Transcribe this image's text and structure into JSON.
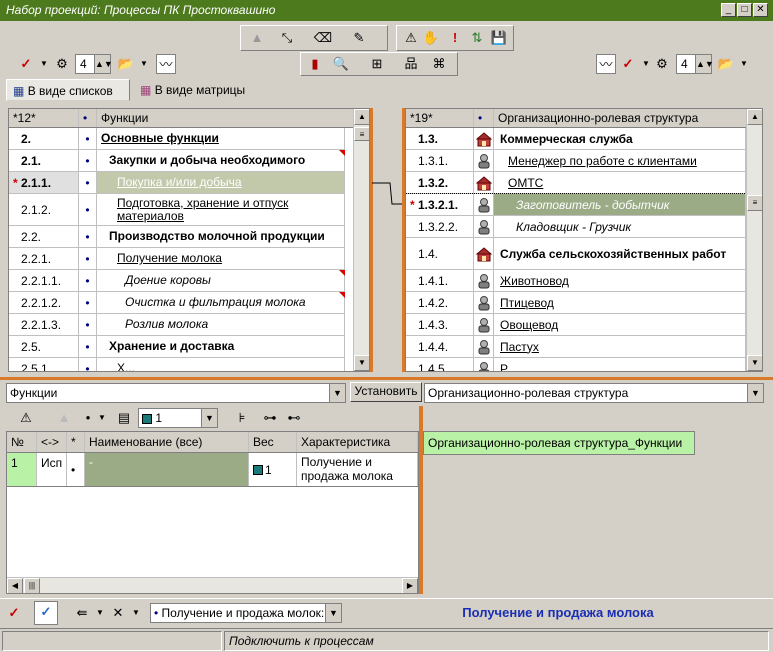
{
  "window": {
    "title": "Набор проекций: Процессы ПК Простоквашино"
  },
  "view_tabs": {
    "list_view": "В виде списков",
    "matrix_view": "В виде матрицы"
  },
  "left_spin": "4",
  "right_spin": "4",
  "left_grid": {
    "header_num": "*12*",
    "header_dot": "•",
    "header_name": "Функции",
    "rows": [
      {
        "mark": "",
        "num": "2.",
        "dot": "•",
        "name": "Основные функции"
      },
      {
        "mark": "",
        "num": "2.1.",
        "dot": "•",
        "name": "Закупки и добыча необходимого"
      },
      {
        "mark": "*",
        "num": "2.1.1.",
        "dot": "•",
        "name": "Покупка и/или добыча"
      },
      {
        "mark": "",
        "num": "2.1.2.",
        "dot": "•",
        "name": "Подготовка, хранение и отпуск материалов"
      },
      {
        "mark": "",
        "num": "2.2.",
        "dot": "•",
        "name": "Производство молочной продукции"
      },
      {
        "mark": "",
        "num": "2.2.1.",
        "dot": "•",
        "name": "Получение молока"
      },
      {
        "mark": "",
        "num": "2.2.1.1.",
        "dot": "•",
        "name": "Доение коровы"
      },
      {
        "mark": "",
        "num": "2.2.1.2.",
        "dot": "•",
        "name": "Очистка и фильтрация молока"
      },
      {
        "mark": "",
        "num": "2.2.1.3.",
        "dot": "•",
        "name": "Розлив молока"
      },
      {
        "mark": "",
        "num": "2.5.",
        "dot": "•",
        "name": "Хранение и доставка"
      },
      {
        "mark": "",
        "num": "2.5.1.",
        "dot": "•",
        "name": "Х..."
      }
    ]
  },
  "right_grid": {
    "header_num": "*19*",
    "header_dot": "•",
    "header_name": "Организационно-ролевая структура",
    "rows": [
      {
        "mark": "",
        "num": "1.3.",
        "name": "Коммерческая служба"
      },
      {
        "mark": "",
        "num": "1.3.1.",
        "name": "Менеджер по работе с клиентами"
      },
      {
        "mark": "",
        "num": "1.3.2.",
        "name": "ОМТС"
      },
      {
        "mark": "*",
        "num": "1.3.2.1.",
        "name": "Заготовитель - добытчик"
      },
      {
        "mark": "",
        "num": "1.3.2.2.",
        "name": "Кладовщик - Грузчик"
      },
      {
        "mark": "",
        "num": "1.4.",
        "name": "Служба сельскохозяйственных работ"
      },
      {
        "mark": "",
        "num": "1.4.1.",
        "name": "Животновод"
      },
      {
        "mark": "",
        "num": "1.4.2.",
        "name": "Птицевод"
      },
      {
        "mark": "",
        "num": "1.4.3.",
        "name": "Овощевод"
      },
      {
        "mark": "",
        "num": "1.4.4.",
        "name": "Пастух"
      },
      {
        "mark": "",
        "num": "1.4.5.",
        "name": "Р..."
      }
    ]
  },
  "bottom": {
    "left_combo": "Функции",
    "set_button": "Установить",
    "right_combo": "Организационно-ролевая структура",
    "level_combo": "1",
    "table_headers": {
      "no": "№",
      "dir": "<->",
      "star": "*",
      "name": "Наименование (все)",
      "weight": "Вес",
      "char": "Характеристика"
    },
    "table_row": {
      "no": "1",
      "dir": "Исп",
      "star": "•",
      "name": "-",
      "weight": "1",
      "char": "Получение и продажа молока"
    },
    "relation_label": "Организационно-ролевая структура_Функции"
  },
  "statusbar": {
    "combo_value": "Получение и продажа молок:",
    "process_label": "Получение и продажа молока",
    "hint": "Подключить к процессам"
  },
  "colors": {
    "title_bg": "#4e7a1e",
    "selected_row": "#c2c8aa",
    "accent_orange": "#d87a2a",
    "relation_green": "#b9f1a6",
    "status_blue": "#1a2eb4"
  }
}
